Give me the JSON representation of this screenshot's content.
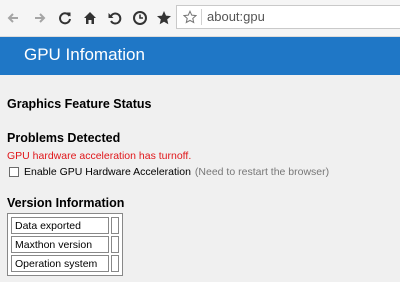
{
  "toolbar": {
    "buttons": [
      "back-icon",
      "forward-icon",
      "reload-icon",
      "home-icon",
      "undo-icon",
      "history-icon",
      "favorites-star-icon"
    ],
    "address": "about:gpu"
  },
  "header": {
    "title": "GPU Infomation"
  },
  "sections": {
    "feature_status": "Graphics Feature Status",
    "problems": "Problems Detected",
    "version": "Version Information"
  },
  "problems": {
    "error": "GPU hardware acceleration has turnoff.",
    "checkbox_label": "Enable GPU Hardware Acceleration",
    "hint": "(Need to restart the browser)"
  },
  "version_table": {
    "rows": [
      {
        "label": "Data exported",
        "value": ""
      },
      {
        "label": "Maxthon version",
        "value": ""
      },
      {
        "label": "Operation system",
        "value": ""
      }
    ]
  },
  "colors": {
    "header_bg": "#1f77c6",
    "error": "#e0161a"
  }
}
